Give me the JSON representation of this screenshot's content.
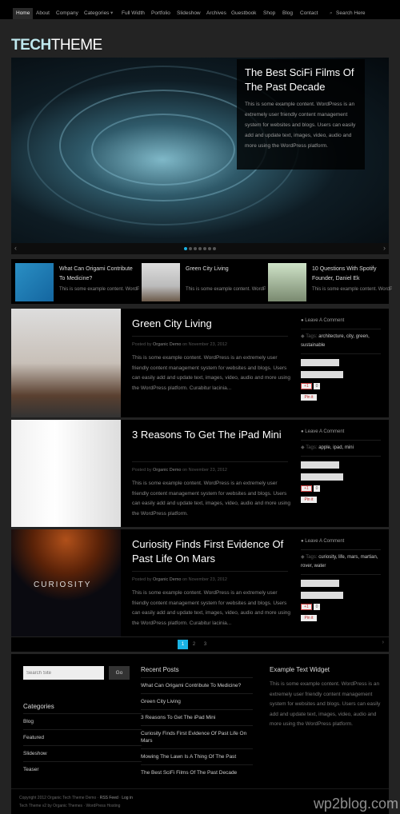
{
  "nav": {
    "items": [
      "Home",
      "About",
      "Company",
      "Categories",
      "Full Width",
      "Portfolio",
      "Slideshow",
      "Archives",
      "Guestbook",
      "Shop",
      "Blog",
      "Contact"
    ],
    "search_placeholder": "Search Here"
  },
  "logo": {
    "bold": "TECH",
    "light": "THEME"
  },
  "slider": {
    "title": "The Best SciFi Films Of The Past Decade",
    "text": "This is some example content. WordPress is an extremely user friendly content management system for websites and blogs. Users can easily add and update text, images, video, audio and more using the WordPress platform.",
    "prev": "‹",
    "next": "›",
    "slides": 7,
    "current": 1
  },
  "teasers": [
    {
      "title": "What Can Origami Contribute To Medicine?",
      "text": "This is some example content. WordPress is an extremely user"
    },
    {
      "title": "Green City Living",
      "text": "This is some example content. WordPress is an extremely user friendly content management"
    },
    {
      "title": "10 Questions With Spotify Founder, Daniel Ek",
      "text": "This is some example content. WordPress is an extremely user"
    }
  ],
  "posts": [
    {
      "title": "Green City Living",
      "posted_by": "Posted by",
      "author": "Organic Demo",
      "on": "on November 23, 2012",
      "excerpt": "This is some example content. WordPress is an extremely user friendly content management system for websites and blogs. Users can easily add and update text, images, video, audio and more using the WordPress platform. Curabitur lacinia...",
      "comment": "Leave A Comment",
      "tags_label": "Tags:",
      "tags": "architecture, city, green, sustainable"
    },
    {
      "title": "3 Reasons To Get The iPad Mini",
      "posted_by": "Posted by",
      "author": "Organic Demo",
      "on": "on November 23, 2012",
      "excerpt": "This is some example content. WordPress is an extremely user friendly content management system for websites and blogs. Users can easily add and update text, images, video, audio and more using the WordPress platform.",
      "comment": "Leave A Comment",
      "tags_label": "Tags:",
      "tags": "apple, ipad, mini"
    },
    {
      "title": "Curiosity Finds First Evidence Of Past Life On Mars",
      "posted_by": "Posted by",
      "author": "Organic Demo",
      "on": "on November 23, 2012",
      "excerpt": "This is some example content. WordPress is an extremely user friendly content management system for websites and blogs. Users can easily add and update text, images, video, audio and more using the WordPress platform. Curabitur lacinia...",
      "comment": "Leave A Comment",
      "tags_label": "Tags:",
      "tags": "curiosity, life, mars, martian, rover, water",
      "image_text": "CURIOSITY"
    }
  ],
  "social": {
    "gplus": "+1",
    "count": "0",
    "pin": "Pin it"
  },
  "pagination": {
    "pages": [
      "1",
      "2",
      "3"
    ],
    "current": "1",
    "next": "›"
  },
  "footer": {
    "search_placeholder": "Search Site",
    "go": "Go",
    "categories_title": "Categories",
    "categories": [
      "Blog",
      "Featured",
      "Slideshow",
      "Teaser"
    ],
    "recent_title": "Recent Posts",
    "recent": [
      "What Can Origami Contribute To Medicine?",
      "Green City Living",
      "3 Reasons To Get The iPad Mini",
      "Curiosity Finds First Evidence Of Past Life On Mars",
      "Mowing The Lawn Is A Thing Of The Past",
      "The Best SciFi Films Of The Past Decade"
    ],
    "widget_title": "Example Text Widget",
    "widget_text": "This is some example content. WordPress is an extremely user friendly content management system for websites and blogs. Users can easily add and update text, images, video, audio and more using the WordPress platform."
  },
  "bottom": {
    "copyright": "Copyright 2012 Organic Tech Theme Demo ·",
    "rss": "RSS Feed",
    "login": "Log in",
    "credit": "Tech Theme v2 by Organic Themes · WordPress Hosting",
    "watermark": "wp2blog.com"
  },
  "colors": {
    "accent": "#1ab2e3",
    "logo_bold": "#bfe8ee",
    "background": "#232323"
  }
}
